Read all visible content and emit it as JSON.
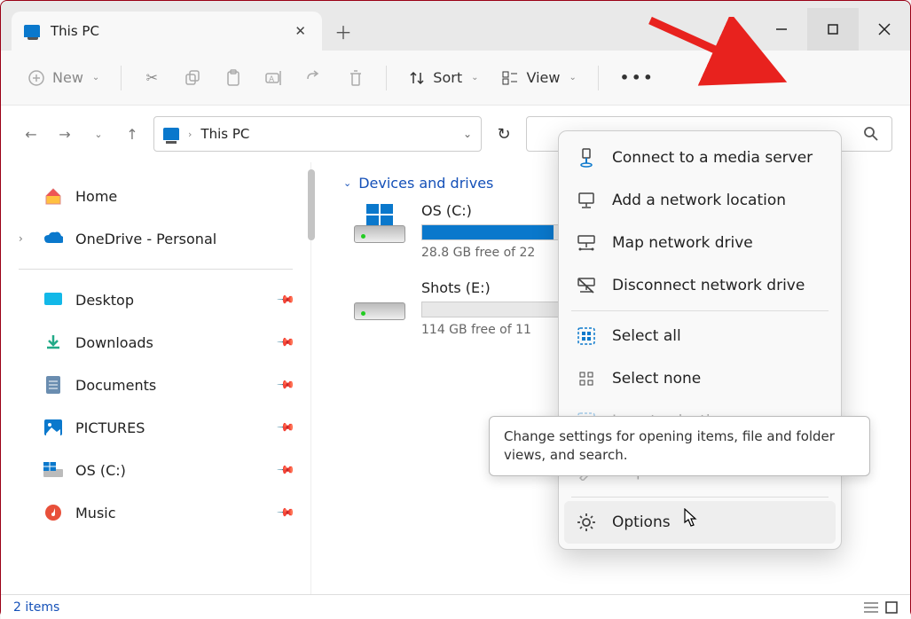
{
  "tab": {
    "title": "This PC"
  },
  "toolbar": {
    "new": "New",
    "sort": "Sort",
    "view": "View"
  },
  "breadcrumb": {
    "location": "This PC"
  },
  "sidebar": {
    "home": "Home",
    "onedrive": "OneDrive - Personal",
    "quick": [
      "Desktop",
      "Downloads",
      "Documents",
      "PICTURES",
      "OS (C:)",
      "Music"
    ]
  },
  "content": {
    "group": "Devices and drives",
    "drives": [
      {
        "name": "OS (C:)",
        "free": "28.8 GB free of 22",
        "fillPct": 88,
        "hasWin": true
      },
      {
        "name": "Shots (E:)",
        "free": "114 GB free of 11",
        "fillPct": 0,
        "hasWin": false
      }
    ]
  },
  "menu": {
    "items": [
      "Connect to a media server",
      "Add a network location",
      "Map network drive",
      "Disconnect network drive",
      "Select all",
      "Select none",
      "Invert selection",
      "Properties",
      "Options"
    ]
  },
  "tooltip": "Change settings for opening items, file and folder views, and search.",
  "status": {
    "count": "2 items"
  }
}
